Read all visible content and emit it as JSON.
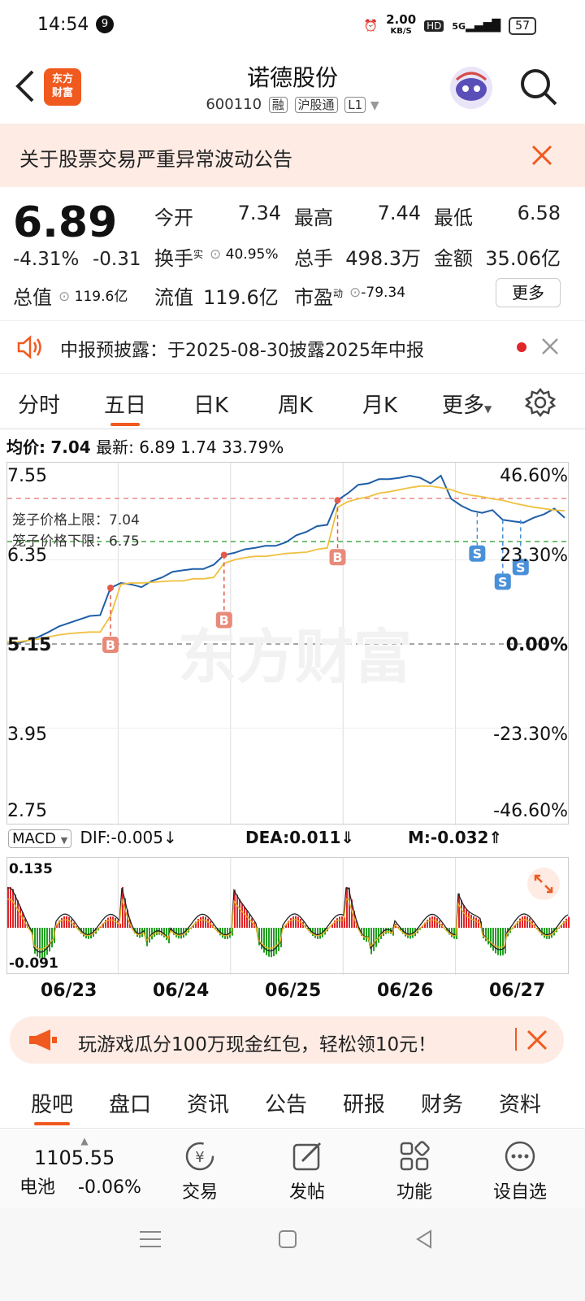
{
  "status": {
    "time": "14:54",
    "notif_count": "9",
    "net_speed": "2.00",
    "net_unit": "KB/S",
    "hd": "HD",
    "signal": "5G",
    "battery": "57"
  },
  "header": {
    "logo_line1": "东方",
    "logo_line2": "财富",
    "title": "诺德股份",
    "code": "600110",
    "tags": [
      "融",
      "沪股通",
      "L1"
    ]
  },
  "notice": {
    "text": "关于股票交易严重异常波动公告"
  },
  "quote": {
    "price": "6.89",
    "change_pct": "-4.31%",
    "change": "-0.31",
    "open_label": "今开",
    "open": "7.34",
    "high_label": "最高",
    "high": "7.44",
    "low_label": "最低",
    "low": "6.58",
    "turnover_label": "换手",
    "turnover_sup": "实",
    "turnover": "40.95%",
    "volume_label": "总手",
    "volume": "498.3万",
    "amount_label": "金额",
    "amount": "35.06亿",
    "mktcap_label": "总值",
    "mktcap": "119.6亿",
    "float_label": "流值",
    "float": "119.6亿",
    "pe_label": "市盈",
    "pe_sup": "动",
    "pe": "-79.34",
    "more": "更多"
  },
  "report": {
    "text": "中报预披露：于2025-08-30披露2025年中报"
  },
  "tabs": [
    "分时",
    "五日",
    "日K",
    "周K",
    "月K",
    "更多"
  ],
  "active_tab": "五日",
  "chart_info": {
    "avg_label": "均价:",
    "avg_value": "7.04",
    "latest_label": "最新:",
    "latest": "6.89",
    "v1": "1.74",
    "v2": "33.79%"
  },
  "chart_data": {
    "type": "line",
    "title": "",
    "y_ticks_left": [
      "7.55",
      "6.35",
      "5.15",
      "3.95",
      "2.75"
    ],
    "y_ticks_right": [
      "46.60%",
      "23.30%",
      "0.00%",
      "-23.30%",
      "-46.60%"
    ],
    "ylim": [
      2.75,
      7.55
    ],
    "base": 5.15,
    "upper_limit_label": "笼子价格上限：",
    "upper_limit": 7.04,
    "lower_limit_label": "笼子价格下限：",
    "lower_limit": 6.75,
    "watermark": "东方财富",
    "x": [
      "06/23",
      "06/24",
      "06/25",
      "06/26",
      "06/27"
    ],
    "series": [
      {
        "values": [
          5.18,
          5.16,
          5.2,
          5.25,
          5.32,
          5.4,
          5.45,
          5.5,
          5.55,
          5.56,
          5.95,
          6.02,
          6.0,
          5.96,
          6.05,
          6.1,
          6.18,
          6.2,
          6.22,
          6.22,
          6.28,
          6.42,
          6.45,
          6.5,
          6.52,
          6.55,
          6.55,
          6.6,
          6.7,
          6.75,
          6.83,
          6.85,
          7.2,
          7.3,
          7.42,
          7.44,
          7.5,
          7.5,
          7.52,
          7.55,
          7.52,
          7.44,
          7.55,
          7.22,
          7.12,
          7.05,
          7.02,
          7.06,
          6.92,
          6.9,
          6.88,
          6.95,
          7.0,
          7.08,
          6.95
        ]
      },
      {
        "values": [
          5.18,
          5.18,
          5.2,
          5.22,
          5.25,
          5.28,
          5.3,
          5.31,
          5.32,
          5.32,
          5.55,
          6.0,
          6.02,
          6.02,
          6.03,
          6.04,
          6.05,
          6.05,
          6.08,
          6.08,
          6.1,
          6.3,
          6.35,
          6.38,
          6.4,
          6.4,
          6.42,
          6.44,
          6.45,
          6.46,
          6.5,
          6.52,
          7.1,
          7.18,
          7.22,
          7.25,
          7.3,
          7.32,
          7.35,
          7.38,
          7.4,
          7.4,
          7.38,
          7.35,
          7.3,
          7.27,
          7.25,
          7.22,
          7.2,
          7.16,
          7.13,
          7.1,
          7.08,
          7.06,
          7.05
        ]
      }
    ],
    "markers_b": [
      "B",
      "B",
      "B"
    ],
    "markers_s": [
      "S",
      "S",
      "S"
    ]
  },
  "macd": {
    "indicator": "MACD",
    "dif": "DIF:-0.005",
    "dea": "DEA:0.011",
    "m": "M:-0.032",
    "top": "0.135",
    "bottom": "-0.091",
    "dates": [
      "06/23",
      "06/24",
      "06/25",
      "06/26",
      "06/27"
    ]
  },
  "promo": {
    "text": "玩游戏瓜分100万现金红包，轻松领10元！"
  },
  "bottom_tabs": [
    "股吧",
    "盘口",
    "资讯",
    "公告",
    "研报",
    "财务",
    "资料"
  ],
  "active_bottom_tab": "股吧",
  "toolbar": {
    "index_value": "1105.55",
    "index_name": "电池",
    "index_change": "-0.06%",
    "trade": "交易",
    "post": "发帖",
    "func": "功能",
    "watch": "设自选"
  }
}
